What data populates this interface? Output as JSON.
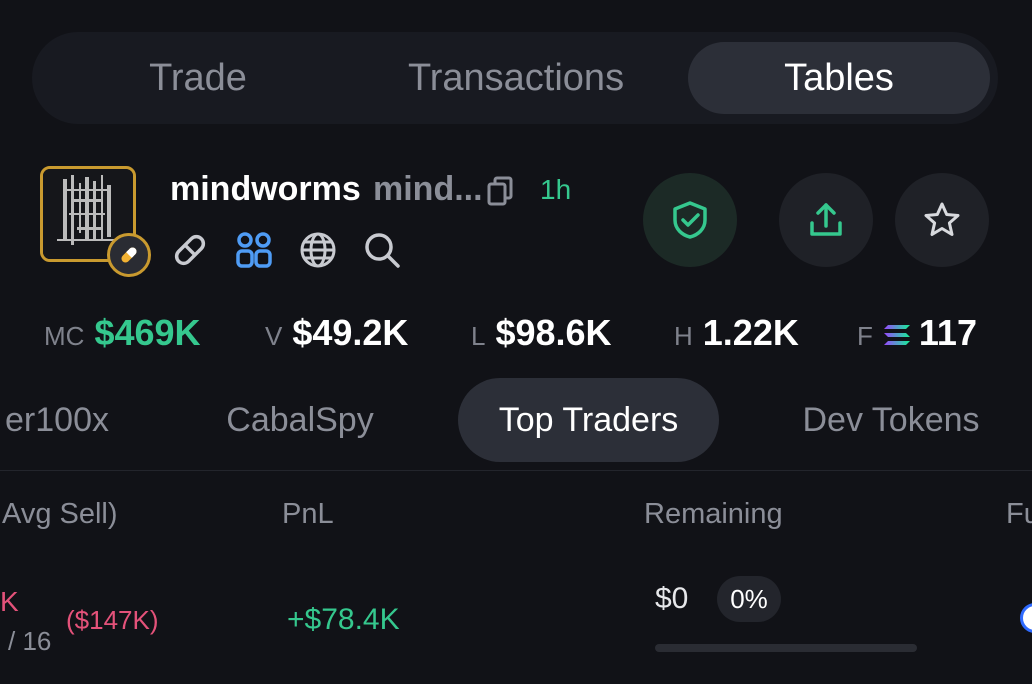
{
  "top_tabs": [
    {
      "label": "Trade",
      "active": false
    },
    {
      "label": "Transactions",
      "active": false
    },
    {
      "label": "Tables",
      "active": true
    }
  ],
  "token": {
    "name": "mindworms",
    "ticker": "mind...",
    "age": "1h",
    "avatar_icon": "pixel-art-avatar",
    "badge_icon": "pill-icon",
    "links": [
      "link-icon",
      "community-icon",
      "globe-icon",
      "search-icon"
    ]
  },
  "actions": [
    "shield-check-icon",
    "share-icon",
    "star-icon"
  ],
  "stats": [
    {
      "label": "MC",
      "value": "$469K",
      "color": "#35c88e"
    },
    {
      "label": "V",
      "value": "$49.2K"
    },
    {
      "label": "L",
      "value": "$98.6K"
    },
    {
      "label": "H",
      "value": "1.22K"
    },
    {
      "label": "F",
      "value": "117",
      "icon": "solana-icon"
    }
  ],
  "sub_tabs": [
    {
      "label": "er100x",
      "active": false
    },
    {
      "label": "CabalSpy",
      "active": false
    },
    {
      "label": "Top Traders",
      "active": true
    },
    {
      "label": "Dev Tokens",
      "active": false
    }
  ],
  "table": {
    "headers": [
      "Avg Sell)",
      "PnL",
      "Remaining",
      "Fu"
    ],
    "rows": [
      {
        "sold": "K",
        "sold_count": "/ 16",
        "avg_sell": "($147K)",
        "pnl": "+$78.4K",
        "remaining": "$0",
        "remaining_pct": "0%",
        "remaining_fraction": 0
      }
    ]
  },
  "colors": {
    "background": "#111217",
    "accent_green": "#35c88e",
    "accent_red": "#e4527a",
    "avatar_border": "#c99a2f"
  }
}
